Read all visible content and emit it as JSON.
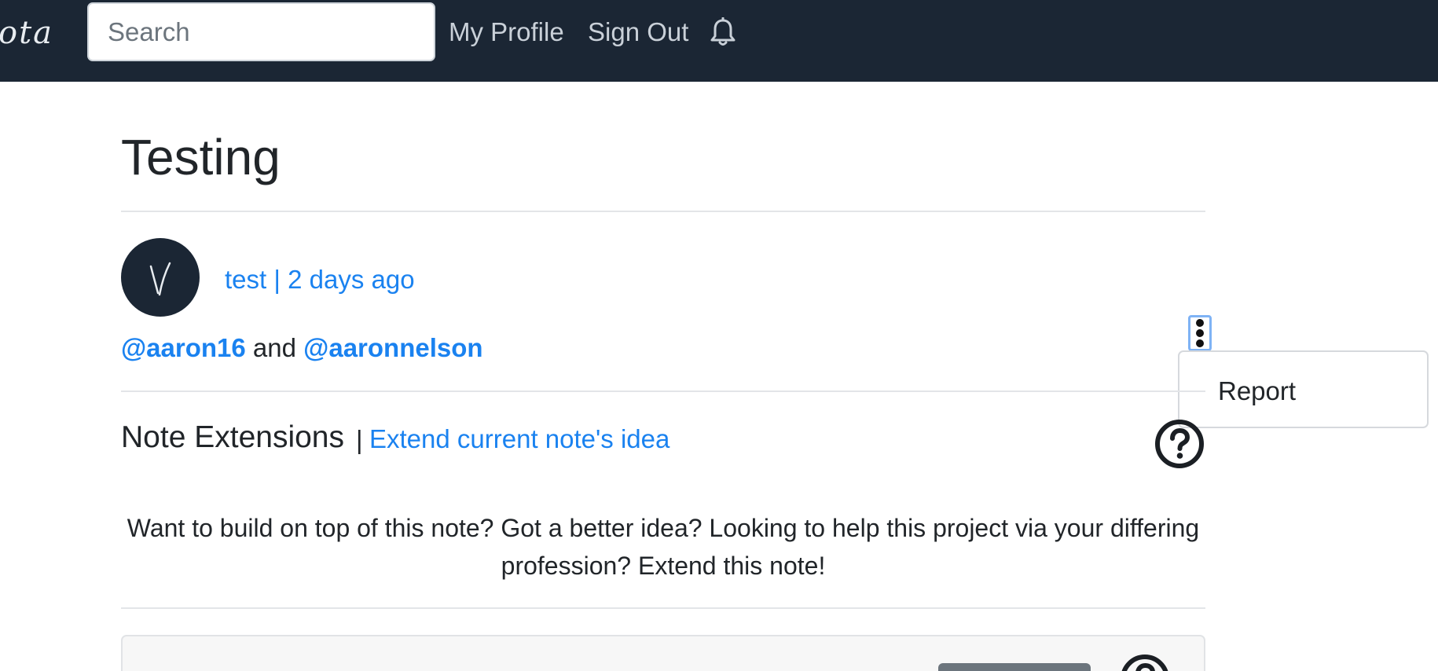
{
  "navbar": {
    "brand": "ota",
    "search": {
      "placeholder": "Search",
      "value": ""
    },
    "links": {
      "my_profile": "My Profile",
      "sign_out": "Sign Out"
    },
    "bell_icon": "bell-icon",
    "background": "#1b2634"
  },
  "note": {
    "title": "Testing",
    "author_avatar_letter": "V",
    "meta": "test | 2 days ago",
    "mentions": {
      "first": "@aaron16",
      "joiner": " and ",
      "second": "@aaronnelson"
    },
    "menu": {
      "icon": "kebab-vertical-icon",
      "items": [
        "Report"
      ]
    }
  },
  "extensions": {
    "heading": "Note Extensions",
    "separator": "|",
    "link": "Extend current note's idea",
    "help_icon": "question-circle-icon",
    "blurb": "Want to build on top of this note? Got a better idea? Looking to help this project via your differing profession? Extend this note!"
  },
  "colors": {
    "link": "#1a82f0",
    "dark": "#1b2634",
    "button_secondary": "#6c757d"
  }
}
